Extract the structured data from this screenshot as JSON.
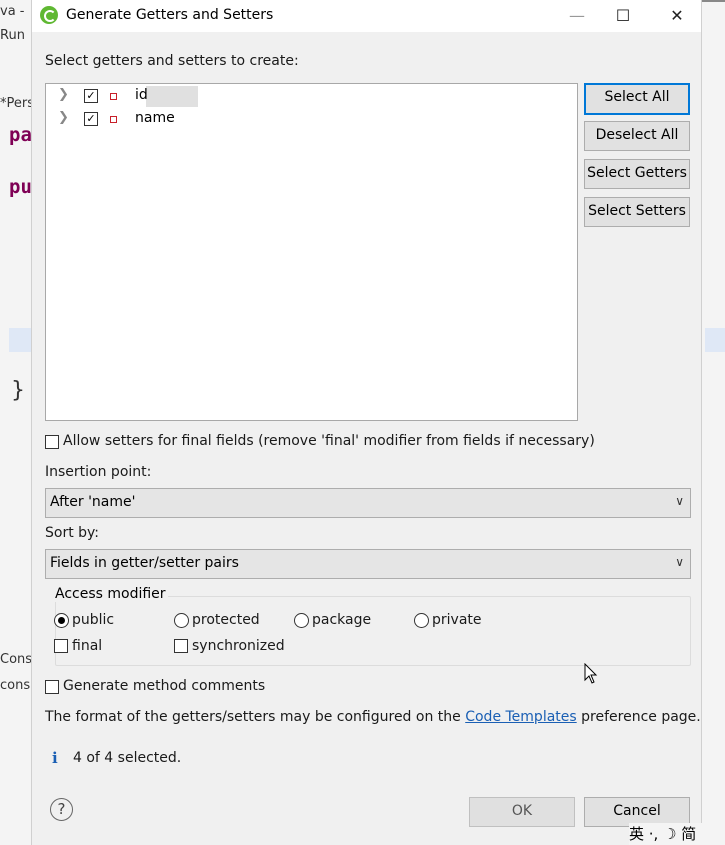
{
  "background": {
    "top_left": "va -",
    "run_label": "Run",
    "tab_label": "*Pers",
    "kw1": "pa",
    "kw2": "pu",
    "brace": "}",
    "cons1": "Cons",
    "cons2": "cons"
  },
  "dialog": {
    "title": "Generate Getters and Setters",
    "minimize_label": "—",
    "maximize_label": "☐",
    "close_label": "✕",
    "select_label": "Select getters and setters to create:",
    "fields": [
      {
        "name": "id",
        "checked": true
      },
      {
        "name": "name",
        "checked": true
      }
    ],
    "buttons": {
      "select_all": "Select All",
      "deselect_all": "Deselect All",
      "select_getters": "Select Getters",
      "select_setters": "Select Setters"
    },
    "allow_setters_label": "Allow setters for final fields (remove 'final' modifier from fields if necessary)",
    "insertion_point_label": "Insertion point:",
    "insertion_point_value": "After 'name'",
    "sort_by_label": "Sort by:",
    "sort_by_value": "Fields in getter/setter pairs",
    "access_modifier": {
      "title": "Access modifier",
      "options": [
        "public",
        "protected",
        "package",
        "private"
      ],
      "selected": "public",
      "final_label": "final",
      "synchronized_label": "synchronized"
    },
    "generate_comments_label": "Generate method comments",
    "format_text_before": "The format of the getters/setters may be configured on the",
    "format_link": "Code Templates",
    "format_text_after": "preference page.",
    "status": "4 of 4 selected.",
    "ok_label": "OK",
    "cancel_label": "Cancel"
  },
  "ime": {
    "text": "英 ·, ☽ 简"
  },
  "colors": {
    "accent": "#0078d7",
    "link": "#1a5fb4",
    "keyword": "#7f0055",
    "field_icon": "#c8202a"
  }
}
